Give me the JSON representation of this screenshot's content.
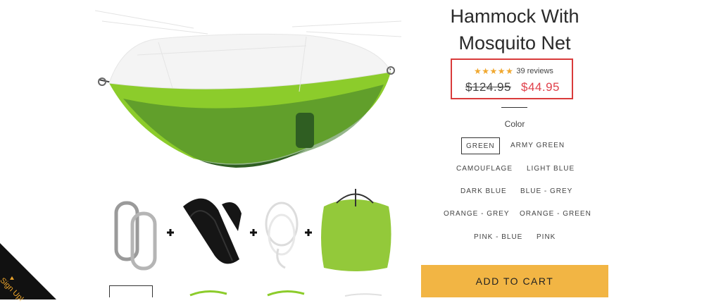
{
  "product": {
    "title_line1": "Hammock With",
    "title_line2": "Mosquito Net",
    "rating": {
      "stars": 5,
      "star_glyph": "★",
      "reviews_text": "39 reviews"
    },
    "compare_price": "$124.95",
    "sale_price": "$44.95",
    "option_label": "Color",
    "colors": [
      "GREEN",
      "ARMY GREEN",
      "CAMOUFLAGE",
      "LIGHT BLUE",
      "DARK BLUE",
      "BLUE - GREY",
      "ORANGE - GREY",
      "ORANGE - GREEN",
      "PINK - BLUE",
      "PINK"
    ],
    "selected_color": "GREEN",
    "add_to_cart_label": "ADD TO CART"
  },
  "signup": {
    "label": "Sign Up!"
  },
  "theme": {
    "accent_button": "#f2b544",
    "sale_price_color": "#e0404a",
    "highlight_border": "#d93b3b",
    "star_color": "#f0a830",
    "hammock_green": "#8ccc2b"
  },
  "icons": [
    "star-icon",
    "plus-icon",
    "carabiner-icon",
    "strap-icon",
    "rope-icon",
    "storage-bag-icon",
    "chevron-up-icon"
  ]
}
